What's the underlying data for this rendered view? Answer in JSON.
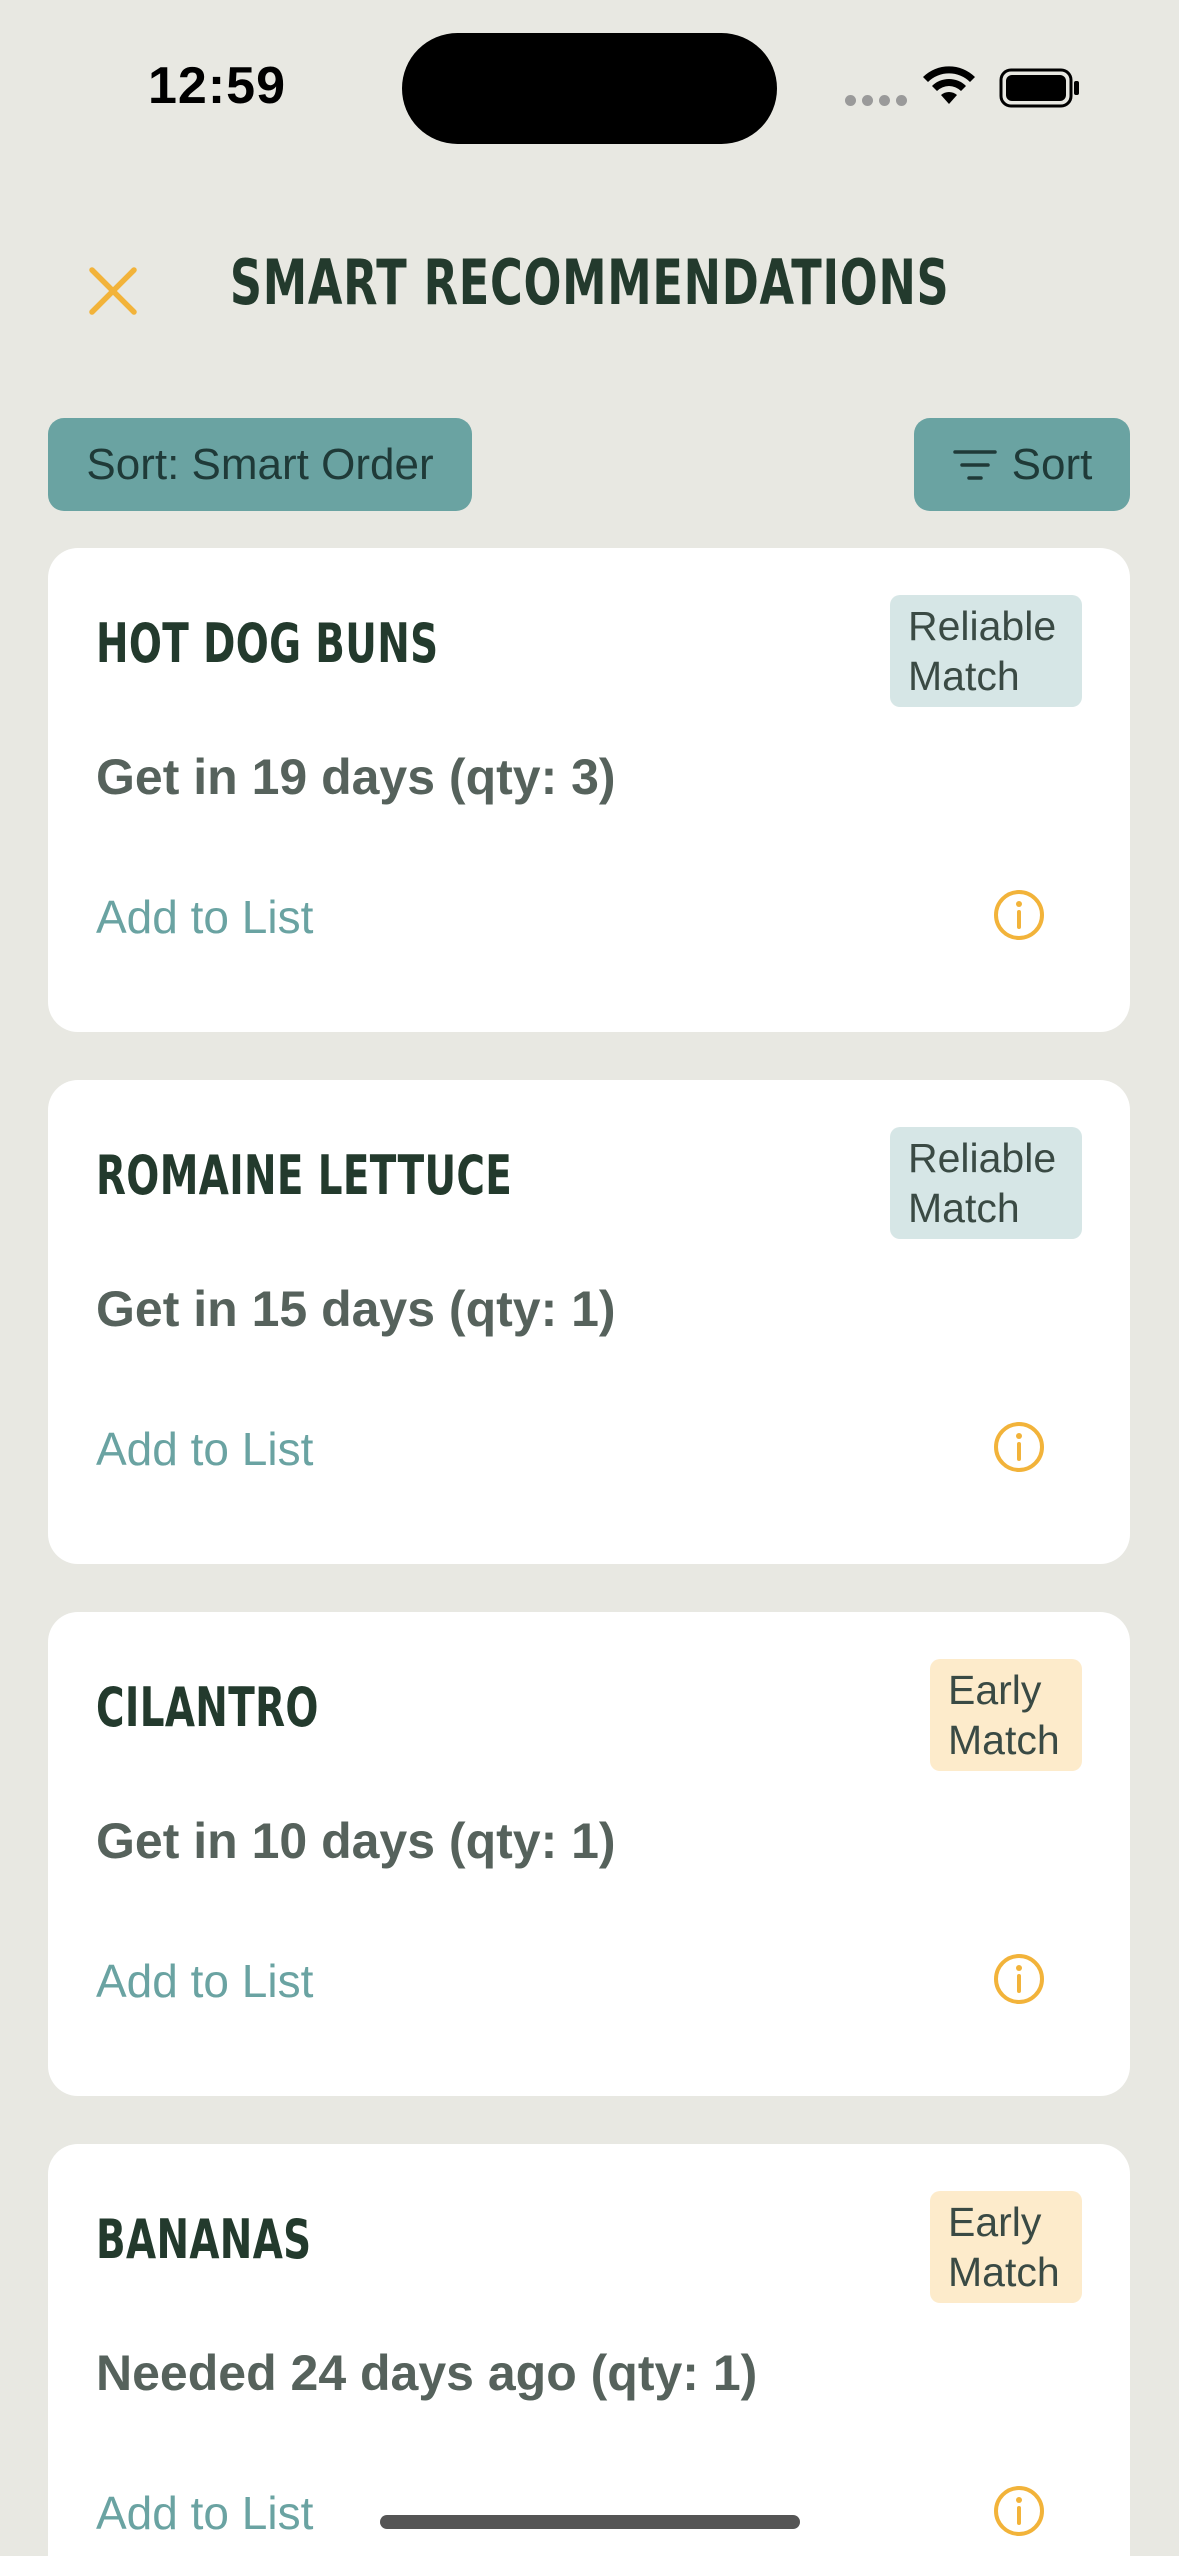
{
  "status_bar": {
    "time": "12:59"
  },
  "header": {
    "title": "SMART RECOMMENDATIONS",
    "close_icon": "close-icon",
    "accent_color": "#f2b33a"
  },
  "controls": {
    "sort_chip_label": "Sort: Smart Order",
    "sort_button_label": "Sort",
    "sort_icon": "sort-lines-icon"
  },
  "recommendations": [
    {
      "name": "HOT DOG BUNS",
      "badge": "Reliable Match",
      "badge_type": "reliable",
      "due": "Get in 19 days (qty: 3)",
      "action": "Add to List"
    },
    {
      "name": "ROMAINE LETTUCE",
      "badge": "Reliable Match",
      "badge_type": "reliable",
      "due": "Get in 15 days (qty: 1)",
      "action": "Add to List"
    },
    {
      "name": "CILANTRO",
      "badge": "Early Match",
      "badge_type": "early",
      "due": "Get in 10 days (qty: 1)",
      "action": "Add to List"
    },
    {
      "name": "BANANAS",
      "badge": "Early Match",
      "badge_type": "early",
      "due": "Needed 24 days ago (qty: 1)",
      "action": "Add to List"
    }
  ],
  "colors": {
    "background": "#e8e8e2",
    "teal": "#6aa3a2",
    "dark_green": "#233a2d",
    "reliable_badge": "#d6e6e6",
    "early_badge": "#fdebcb"
  }
}
